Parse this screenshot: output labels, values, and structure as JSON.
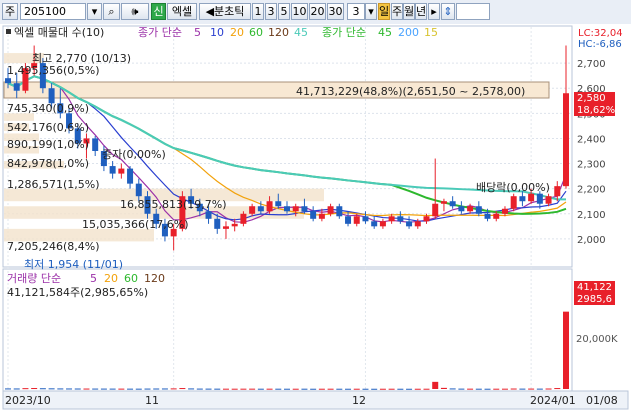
{
  "toolbar": {
    "market_select": "주",
    "code_value": "205100",
    "new_badge": "신",
    "excel_label": "엑셀",
    "tick_toggle": "◀분초틱",
    "intervals": [
      "1",
      "3",
      "5",
      "10",
      "20",
      "30"
    ],
    "interval_value": "3",
    "period_badge": "일",
    "periods": [
      "주",
      "월",
      "년"
    ]
  },
  "legend": {
    "price_series": "엑셀 매물대 수(10)",
    "ma_title": "종가 단순",
    "ma_short": [
      "5",
      "10",
      "20",
      "60",
      "120"
    ],
    "ma2_title": "종가 단순",
    "ma_long": [
      "45",
      "200",
      "15"
    ],
    "lc_label": "LC:32,04",
    "hc_label": "HC:-6,86"
  },
  "volume_profile": [
    {
      "label": "1,495,356(0,5%)"
    },
    {
      "label": "745,340(0,9%)"
    },
    {
      "label": "542,176(0,6%)"
    },
    {
      "label": "890,199(1,0%)"
    },
    {
      "label": "842,978(1,0%)"
    },
    {
      "label": "1,286,571(1,5%)"
    },
    {
      "label": "16,855,813(19,7%)"
    },
    {
      "label": "15,035,366(17,6%)"
    },
    {
      "label": "7,205,246(8,4%)"
    }
  ],
  "annotations": {
    "max_label": "최고 2,770 (10/13)",
    "min_label": "최저 1,954 (11/01)",
    "box_label": "41,713,229(48,8%)(2,651,50 ~ 2,578,00)",
    "rights_label": "증자(0,00%)",
    "dividend_label": "배당락(0,00%)"
  },
  "price_axis": {
    "ticks": [
      "2,700",
      "2,600",
      "2,500",
      "2,400",
      "2,300",
      "2,200",
      "2,100",
      "2,000"
    ],
    "current_price": "2,580",
    "change_pct": "18,62%"
  },
  "volume_panel": {
    "title": "거래량 단순",
    "ma": [
      "5",
      "20",
      "60",
      "120"
    ],
    "last_volume": "41,121,584주(2,985,65%)",
    "axis_ticks": [
      "20,000K"
    ],
    "current_tag": "41,122",
    "current_pct": "2985,6"
  },
  "date_axis": [
    "2023/10",
    "11",
    "12",
    "2024/01",
    "01/08"
  ],
  "colors": {
    "up": "#e8202a",
    "down": "#1f5fbf",
    "ma5": "#9b30a8",
    "ma10": "#2a3fd0",
    "ma20": "#f2a20c",
    "ma60": "#2eb82e",
    "ma120": "#6b3b1a",
    "ma45": "#4bcab8",
    "ma200": "#4aa3ff",
    "ma15": "#d7c32f",
    "box": "#f8e8d3"
  },
  "chart_data": {
    "type": "candlestick",
    "x": [
      "10/04",
      "10/05",
      "10/06",
      "10/10",
      "10/11",
      "10/12",
      "10/13",
      "10/16",
      "10/17",
      "10/18",
      "10/19",
      "10/20",
      "10/23",
      "10/24",
      "10/25",
      "10/26",
      "10/27",
      "10/30",
      "10/31",
      "11/01",
      "11/02",
      "11/03",
      "11/06",
      "11/07",
      "11/08",
      "11/09",
      "11/10",
      "11/13",
      "11/14",
      "11/15",
      "11/16",
      "11/17",
      "11/20",
      "11/21",
      "11/22",
      "11/23",
      "11/24",
      "11/27",
      "11/28",
      "11/29",
      "11/30",
      "12/01",
      "12/04",
      "12/05",
      "12/06",
      "12/07",
      "12/08",
      "12/11",
      "12/12",
      "12/13",
      "12/14",
      "12/15",
      "12/18",
      "12/19",
      "12/20",
      "12/21",
      "12/22",
      "12/26",
      "12/27",
      "12/28",
      "01/02",
      "01/03",
      "01/04",
      "01/05",
      "01/08"
    ],
    "ohlc": [
      [
        2640,
        2680,
        2600,
        2620
      ],
      [
        2620,
        2660,
        2560,
        2590
      ],
      [
        2590,
        2700,
        2580,
        2680
      ],
      [
        2680,
        2770,
        2650,
        2700
      ],
      [
        2700,
        2720,
        2580,
        2600
      ],
      [
        2600,
        2620,
        2520,
        2540
      ],
      [
        2540,
        2600,
        2480,
        2500
      ],
      [
        2500,
        2520,
        2420,
        2440
      ],
      [
        2440,
        2460,
        2360,
        2380
      ],
      [
        2380,
        2420,
        2320,
        2400
      ],
      [
        2400,
        2410,
        2330,
        2350
      ],
      [
        2350,
        2370,
        2270,
        2290
      ],
      [
        2290,
        2310,
        2240,
        2260
      ],
      [
        2260,
        2300,
        2240,
        2280
      ],
      [
        2280,
        2290,
        2200,
        2220
      ],
      [
        2220,
        2240,
        2150,
        2170
      ],
      [
        2170,
        2190,
        2080,
        2100
      ],
      [
        2100,
        2120,
        2040,
        2060
      ],
      [
        2060,
        2080,
        1990,
        2010
      ],
      [
        2010,
        2060,
        1954,
        2040
      ],
      [
        2040,
        2190,
        2030,
        2170
      ],
      [
        2170,
        2200,
        2120,
        2140
      ],
      [
        2140,
        2160,
        2090,
        2110
      ],
      [
        2110,
        2130,
        2060,
        2080
      ],
      [
        2080,
        2100,
        2020,
        2040
      ],
      [
        2040,
        2070,
        2000,
        2050
      ],
      [
        2050,
        2080,
        2030,
        2060
      ],
      [
        2060,
        2110,
        2050,
        2100
      ],
      [
        2100,
        2140,
        2090,
        2130
      ],
      [
        2130,
        2150,
        2100,
        2110
      ],
      [
        2110,
        2170,
        2100,
        2150
      ],
      [
        2150,
        2180,
        2120,
        2130
      ],
      [
        2130,
        2150,
        2100,
        2110
      ],
      [
        2110,
        2140,
        2090,
        2130
      ],
      [
        2130,
        2160,
        2100,
        2110
      ],
      [
        2110,
        2130,
        2070,
        2080
      ],
      [
        2080,
        2120,
        2070,
        2100
      ],
      [
        2100,
        2140,
        2090,
        2130
      ],
      [
        2130,
        2140,
        2080,
        2090
      ],
      [
        2090,
        2110,
        2050,
        2060
      ],
      [
        2060,
        2100,
        2050,
        2090
      ],
      [
        2090,
        2110,
        2060,
        2070
      ],
      [
        2070,
        2090,
        2040,
        2050
      ],
      [
        2050,
        2080,
        2040,
        2070
      ],
      [
        2070,
        2100,
        2060,
        2090
      ],
      [
        2090,
        2110,
        2060,
        2070
      ],
      [
        2070,
        2090,
        2040,
        2050
      ],
      [
        2050,
        2080,
        2040,
        2070
      ],
      [
        2070,
        2100,
        2060,
        2090
      ],
      [
        2090,
        2320,
        2080,
        2140
      ],
      [
        2140,
        2160,
        2110,
        2150
      ],
      [
        2150,
        2170,
        2120,
        2130
      ],
      [
        2130,
        2150,
        2100,
        2110
      ],
      [
        2110,
        2140,
        2100,
        2130
      ],
      [
        2130,
        2150,
        2090,
        2100
      ],
      [
        2100,
        2120,
        2070,
        2080
      ],
      [
        2080,
        2110,
        2070,
        2100
      ],
      [
        2100,
        2130,
        2090,
        2120
      ],
      [
        2120,
        2180,
        2110,
        2170
      ],
      [
        2170,
        2190,
        2130,
        2150
      ],
      [
        2150,
        2200,
        2140,
        2180
      ],
      [
        2180,
        2190,
        2120,
        2140
      ],
      [
        2140,
        2180,
        2130,
        2170
      ],
      [
        2170,
        2230,
        2150,
        2210
      ],
      [
        2210,
        2770,
        2200,
        2580
      ]
    ],
    "volume": [
      300,
      280,
      450,
      520,
      400,
      350,
      300,
      280,
      260,
      240,
      230,
      220,
      210,
      200,
      190,
      180,
      230,
      260,
      280,
      320,
      500,
      300,
      220,
      200,
      180,
      170,
      160,
      170,
      180,
      160,
      170,
      160,
      150,
      150,
      160,
      140,
      150,
      160,
      150,
      140,
      150,
      140,
      130,
      140,
      150,
      140,
      130,
      140,
      150,
      3800,
      600,
      300,
      200,
      180,
      160,
      150,
      160,
      170,
      250,
      200,
      220,
      200,
      260,
      500,
      41122
    ],
    "ylim": [
      1900,
      2800
    ],
    "vol_ylim": [
      0,
      42000
    ]
  }
}
